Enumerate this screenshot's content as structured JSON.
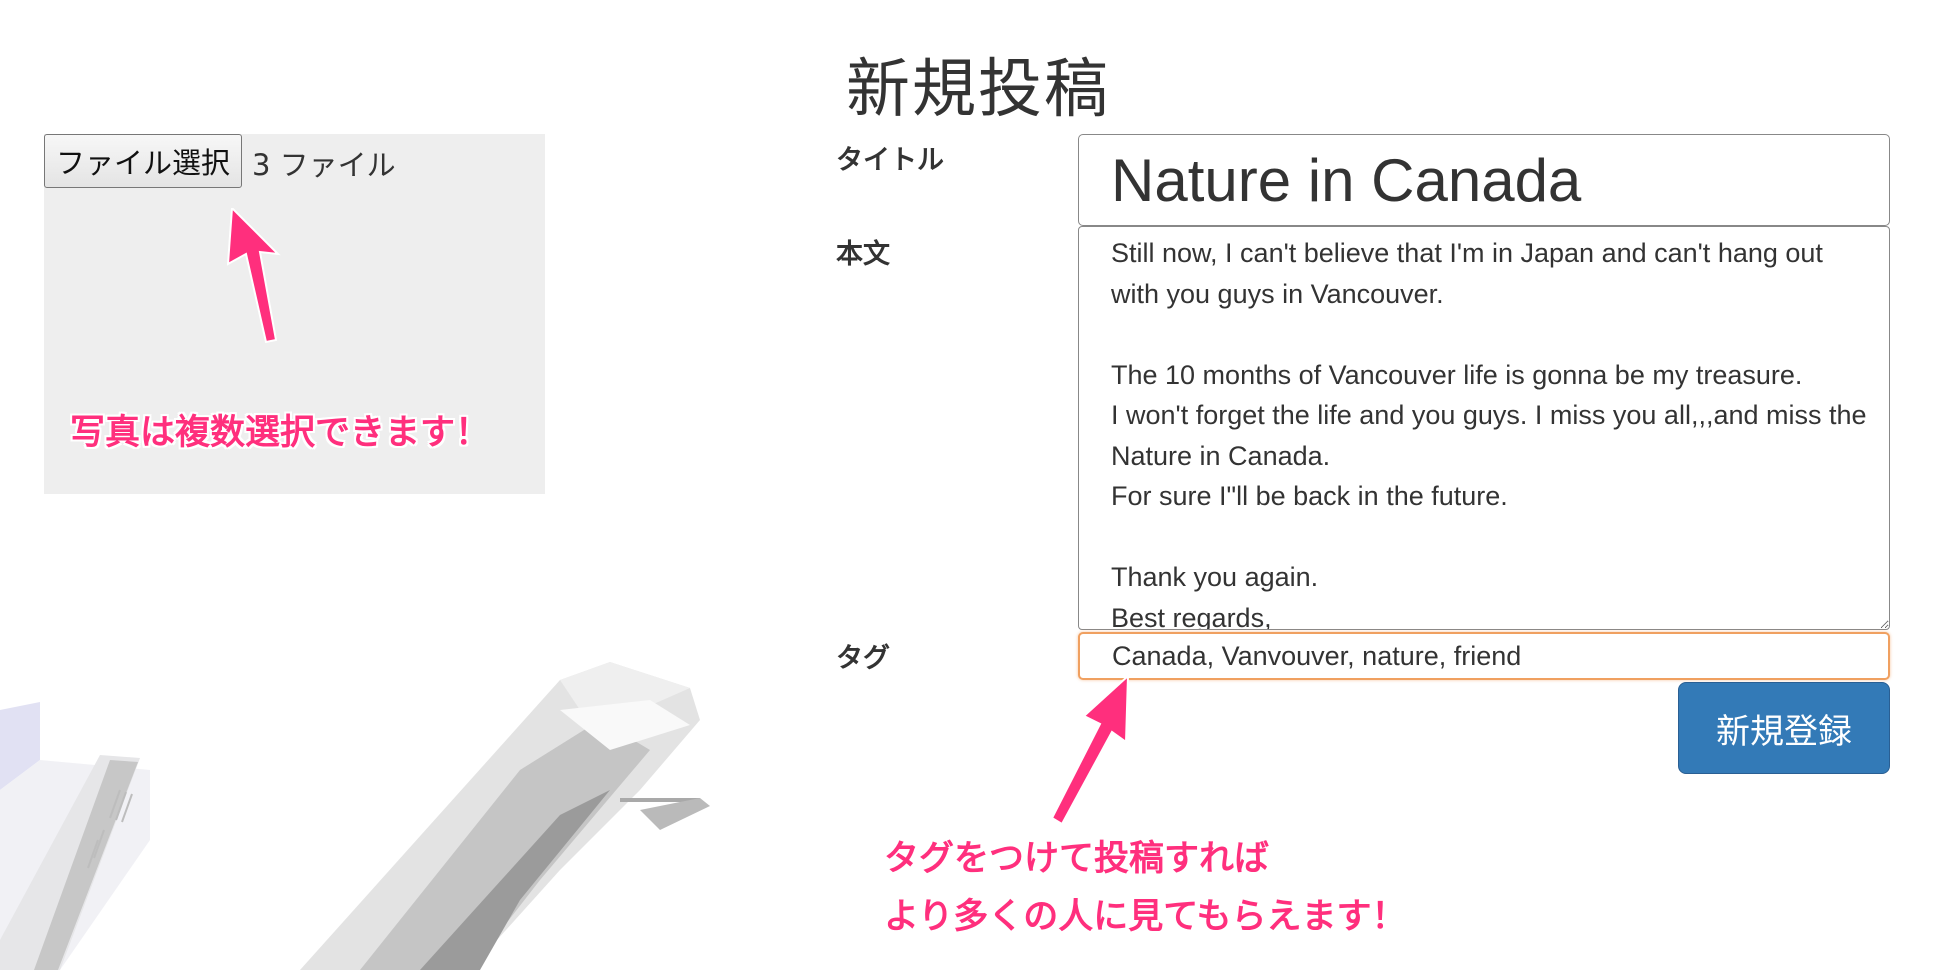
{
  "page": {
    "title": "新規投稿"
  },
  "upload": {
    "button_label": "ファイル選択",
    "file_count_text": "3 ファイル"
  },
  "form": {
    "title_label": "タイトル",
    "title_value": "Nature in Canada",
    "body_label": "本文",
    "body_value": "Still now, I can't believe that I'm in Japan and can't hang out with you guys in Vancouver.\n\nThe 10 months of Vancouver life is gonna be my treasure.\nI won't forget the life and you guys. I miss you all,,,and miss the Nature in Canada.\nFor sure I\"ll be back in the future.\n\nThank you again.\nBest regards,",
    "tag_label": "タグ",
    "tag_value": "Canada, Vanvouver, nature, friend",
    "submit_label": "新規登録"
  },
  "annotations": {
    "photo_note": "写真は複数選択できます！",
    "tag_note_line1": "タグをつけて投稿すれば",
    "tag_note_line2": "より多くの人に見てもらえます！"
  },
  "colors": {
    "annotation": "#ff2f7d",
    "submit_button": "#337ab7",
    "tag_focus_border": "#f0a060",
    "upload_panel": "#eeeeee"
  },
  "icons": {
    "arrow": "pink-arrow-icon"
  }
}
